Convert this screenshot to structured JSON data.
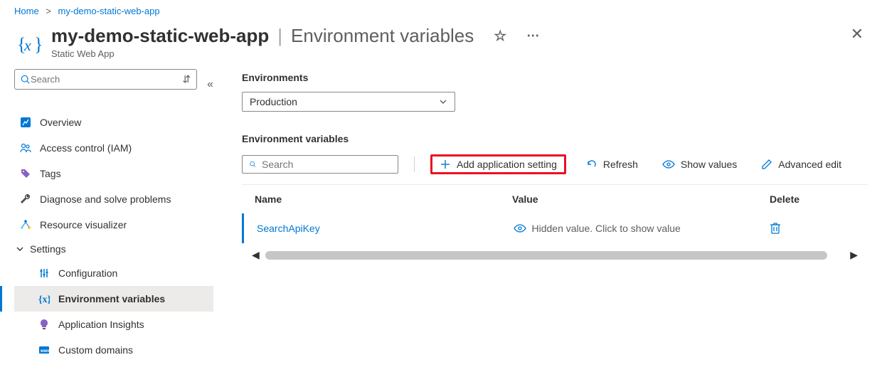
{
  "breadcrumb": {
    "home": "Home",
    "app": "my-demo-static-web-app"
  },
  "header": {
    "title": "my-demo-static-web-app",
    "section": "Environment variables",
    "subtitle": "Static Web App"
  },
  "sidebar": {
    "search_placeholder": "Search",
    "items": {
      "overview": "Overview",
      "iam": "Access control (IAM)",
      "tags": "Tags",
      "diagnose": "Diagnose and solve problems",
      "resviz": "Resource visualizer",
      "settings_group": "Settings",
      "configuration": "Configuration",
      "envvars": "Environment variables",
      "appinsights": "Application Insights",
      "customdomains": "Custom domains"
    }
  },
  "main": {
    "env_label": "Environments",
    "env_selected": "Production",
    "vars_label": "Environment variables",
    "search_placeholder": "Search",
    "toolbar": {
      "add": "Add application setting",
      "refresh": "Refresh",
      "show": "Show values",
      "advanced": "Advanced edit"
    },
    "table": {
      "col_name": "Name",
      "col_value": "Value",
      "col_delete": "Delete",
      "rows": [
        {
          "name": "SearchApiKey",
          "value_masked": "Hidden value. Click to show value"
        }
      ]
    }
  }
}
